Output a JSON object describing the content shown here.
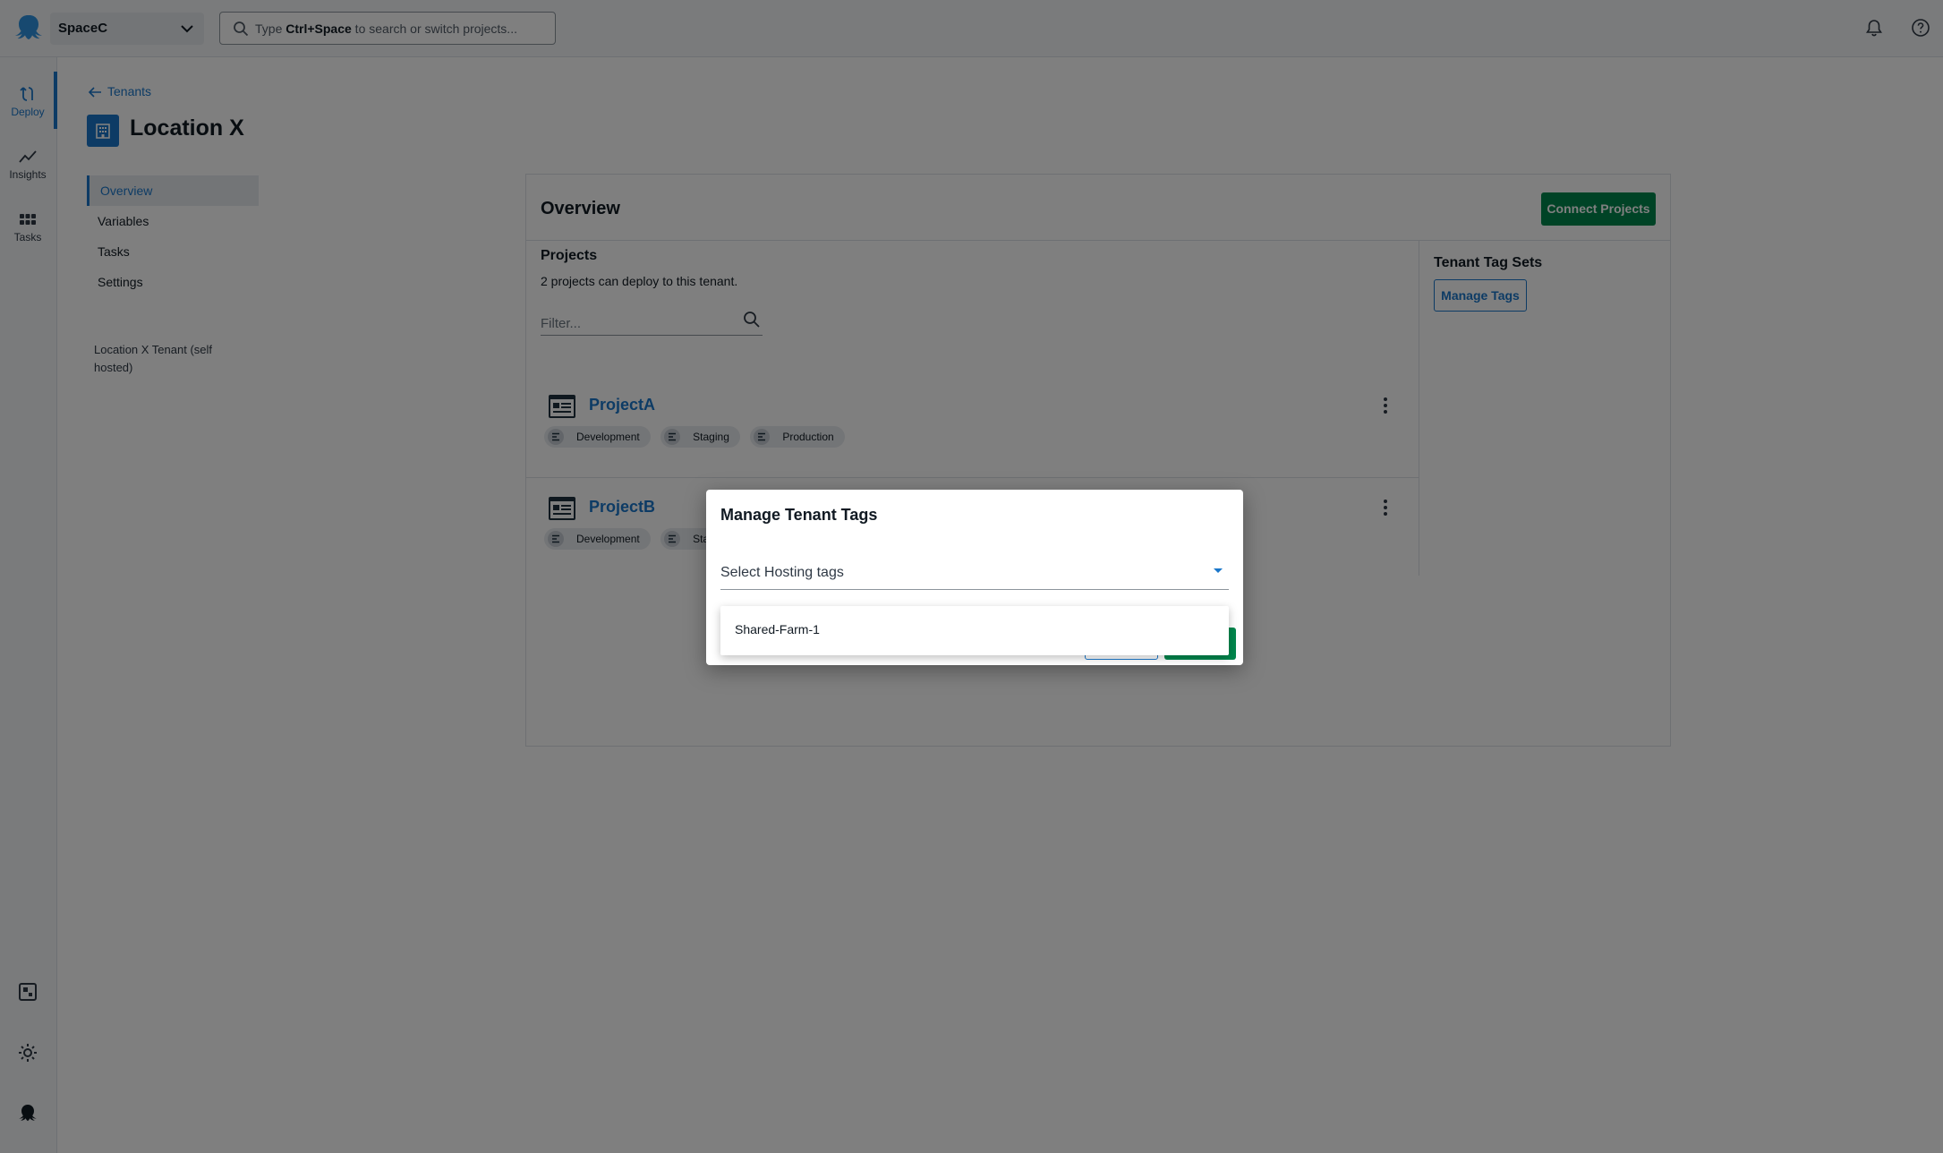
{
  "topbar": {
    "space_name": "SpaceC",
    "search_placeholder_pre": "Type ",
    "search_placeholder_key": "Ctrl+Space",
    "search_placeholder_post": " to search or switch projects..."
  },
  "rail": {
    "items": [
      {
        "label": "Deploy",
        "icon": "deploy-icon"
      },
      {
        "label": "Insights",
        "icon": "insights-icon"
      },
      {
        "label": "Tasks",
        "icon": "tasks-icon"
      }
    ]
  },
  "breadcrumb": {
    "label": "Tenants"
  },
  "page": {
    "title": "Location X"
  },
  "subnav": {
    "items": [
      "Overview",
      "Variables",
      "Tasks",
      "Settings"
    ],
    "active": "Overview"
  },
  "tenant": {
    "description": "Location X Tenant (self hosted)"
  },
  "overview": {
    "title": "Overview",
    "connect_button": "Connect Projects",
    "projects_heading": "Projects",
    "projects_summary": "2 projects can deploy to this tenant.",
    "filter_placeholder": "Filter...",
    "projects": [
      {
        "name": "ProjectA",
        "environments": [
          "Development",
          "Staging",
          "Production"
        ]
      },
      {
        "name": "ProjectB",
        "environments": [
          "Development",
          "Sta"
        ]
      }
    ],
    "tag_sets_heading": "Tenant Tag Sets",
    "manage_tags_button": "Manage Tags"
  },
  "dialog": {
    "title": "Manage Tenant Tags",
    "select_placeholder": "Select Hosting tags",
    "options": [
      "Shared-Farm-1"
    ]
  },
  "colors": {
    "accent": "#1a77ca",
    "primary_button": "#00874d",
    "overlay": "rgba(0,0,0,0.5)"
  }
}
